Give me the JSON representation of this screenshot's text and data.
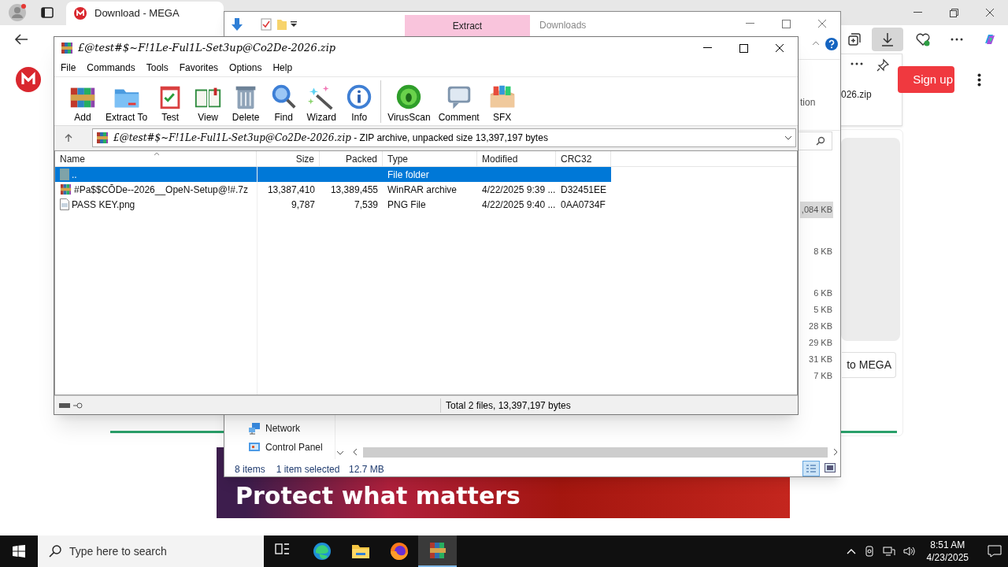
{
  "browser": {
    "tab_title": "Download - MEGA",
    "downloads_file": "026.zip",
    "signup": "Sign up",
    "to_mega": "to MEGA",
    "banner": "Protect what matters"
  },
  "explorer": {
    "title": "Downloads",
    "ribbon_tab": "Extract",
    "ribbon_fragment": "tion",
    "sizes": [
      {
        "text": ",084 KB",
        "selected": true
      },
      {
        "text": "8 KB",
        "selected": false
      },
      {
        "text": "6 KB",
        "selected": false
      },
      {
        "text": "5 KB",
        "selected": false
      },
      {
        "text": "28 KB",
        "selected": false
      },
      {
        "text": "29 KB",
        "selected": false
      },
      {
        "text": "31 KB",
        "selected": false
      },
      {
        "text": "7 KB",
        "selected": false
      }
    ],
    "nav": [
      {
        "kind": "network",
        "label": "Network"
      },
      {
        "kind": "control",
        "label": "Control Panel"
      }
    ],
    "status": {
      "items": "8 items",
      "selection": "1 item selected",
      "size": "12.7 MB"
    }
  },
  "winrar": {
    "title": "£@test#$~F!1Le-Ful1L-Set3up@Co2De-2026.zip",
    "menu": [
      "File",
      "Commands",
      "Tools",
      "Favorites",
      "Options",
      "Help"
    ],
    "toolbar": [
      {
        "kind": "add",
        "label": "Add"
      },
      {
        "kind": "extract",
        "label": "Extract To"
      },
      {
        "kind": "test",
        "label": "Test"
      },
      {
        "kind": "view",
        "label": "View"
      },
      {
        "kind": "delete",
        "label": "Delete"
      },
      {
        "kind": "find",
        "label": "Find"
      },
      {
        "kind": "wizard",
        "label": "Wizard"
      },
      {
        "kind": "info",
        "label": "Info"
      },
      {
        "kind": "virus",
        "label": "VirusScan"
      },
      {
        "kind": "comment",
        "label": "Comment"
      },
      {
        "kind": "sfx",
        "label": "SFX"
      }
    ],
    "path_name": "£@test#$~F!1Le-Ful1L-Set3up@Co2De-2026.zip",
    "path_info": " - ZIP archive, unpacked size 13,397,197 bytes",
    "columns": [
      "Name",
      "Size",
      "Packed",
      "Type",
      "Modified",
      "CRC32"
    ],
    "rows": [
      {
        "kind": "folder",
        "selected": true,
        "cells": [
          "..",
          "",
          "",
          "File folder",
          "",
          ""
        ]
      },
      {
        "kind": "archive",
        "selected": false,
        "cells": [
          "#Pa$$CŌDe--2026__OpeN-Setup@!#.7z",
          "13,387,410",
          "13,389,455",
          "WinRAR archive",
          "4/22/2025 9:39 ...",
          "D32451EE"
        ]
      },
      {
        "kind": "image",
        "selected": false,
        "cells": [
          "PASS KEY.png",
          "9,787",
          "7,539",
          "PNG File",
          "4/22/2025 9:40 ...",
          "0AA0734F"
        ]
      }
    ],
    "status": "Total 2 files, 13,397,197 bytes"
  },
  "taskbar": {
    "search": "Type here to search",
    "time": "8:51 AM",
    "date": "4/23/2025",
    "apps": [
      {
        "kind": "taskview",
        "active": false
      },
      {
        "kind": "edge",
        "active": false
      },
      {
        "kind": "folder",
        "active": false
      },
      {
        "kind": "firefox",
        "active": false
      },
      {
        "kind": "winrar",
        "active": true
      }
    ]
  }
}
